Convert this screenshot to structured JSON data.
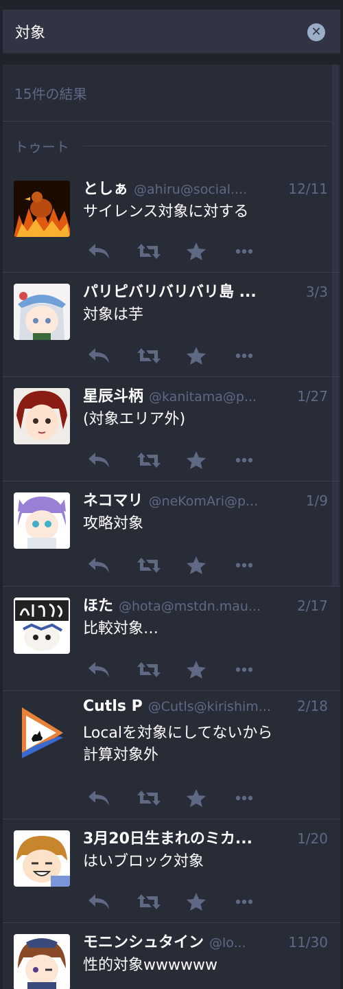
{
  "search": {
    "value": "対象"
  },
  "results": {
    "count_label": "15件の結果",
    "section_label": "トゥート"
  },
  "colors": {
    "icon": "#606984"
  },
  "statuses": [
    {
      "display_name": "としぁ",
      "acct": "@ahiru@social....",
      "time": "12/11",
      "text": "サイレンス対象に対する"
    },
    {
      "display_name": "パリピバリバリバリ島 ...",
      "acct": "",
      "time": "3/3",
      "text": "対象は芋"
    },
    {
      "display_name": "星辰斗柄",
      "acct": "@kanitama@p...",
      "time": "1/27",
      "text": "(対象エリア外)"
    },
    {
      "display_name": "ネコマリ",
      "acct": "@neKomAri@p...",
      "time": "1/9",
      "text": "攻略対象"
    },
    {
      "display_name": "ほた",
      "acct": "@hota@mstdn.mau...",
      "time": "2/17",
      "text": "比較対象…"
    },
    {
      "display_name": "Cutls P",
      "acct": "@Cutls@kirishim...",
      "time": "2/18",
      "text_line1": "Localを対象にしてないから",
      "text_line2": "計算対象外"
    },
    {
      "display_name": "3月20日生まれのミカ...",
      "acct": "",
      "time": "1/20",
      "text": "はいブロック対象"
    },
    {
      "display_name": "モニンシュタイン",
      "acct": "@lo...",
      "time": "11/30",
      "text": "性的対象wwwwww"
    }
  ]
}
